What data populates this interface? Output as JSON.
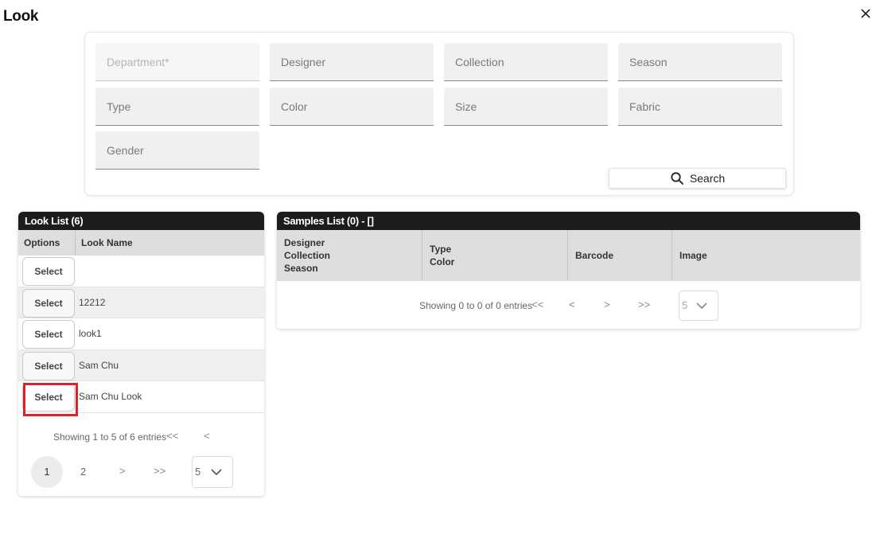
{
  "dialog": {
    "title": "Look"
  },
  "filters": {
    "department": "Department*",
    "designer": "Designer",
    "collection": "Collection",
    "season": "Season",
    "type": "Type",
    "color": "Color",
    "size": "Size",
    "fabric": "Fabric",
    "gender": "Gender"
  },
  "search_button": {
    "label": "Search",
    "icon": "search-icon"
  },
  "look_list": {
    "title": "Look List (6)",
    "columns": [
      "Options",
      "Look Name"
    ],
    "select_label": "Select",
    "rows": [
      {
        "name": ""
      },
      {
        "name": "12212"
      },
      {
        "name": "look1"
      },
      {
        "name": "Sam Chu"
      },
      {
        "name": "Sam Chu Look"
      }
    ],
    "pagination": {
      "info": "Showing 1 to 5 of 6 entries",
      "first": "<<",
      "prev": "<",
      "pages": [
        "1",
        "2"
      ],
      "current_page": "1",
      "next": ">",
      "last": ">>",
      "page_size": "5"
    }
  },
  "samples_list": {
    "title": "Samples List (0) - []",
    "columns": [
      {
        "lines": [
          "Designer",
          "Collection",
          "Season"
        ]
      },
      {
        "lines": [
          "Type",
          "Color"
        ]
      },
      {
        "lines": [
          "Barcode"
        ]
      },
      {
        "lines": [
          "Image"
        ]
      }
    ],
    "pagination": {
      "info": "Showing 0 to 0 of 0 entries",
      "first": "<<",
      "prev": "<",
      "next": ">",
      "last": ">>",
      "page_size": "5"
    }
  },
  "colors": {
    "header_bg": "#1c1c1c",
    "table_head_bg": "#dedede",
    "highlight": "#d9252a"
  }
}
